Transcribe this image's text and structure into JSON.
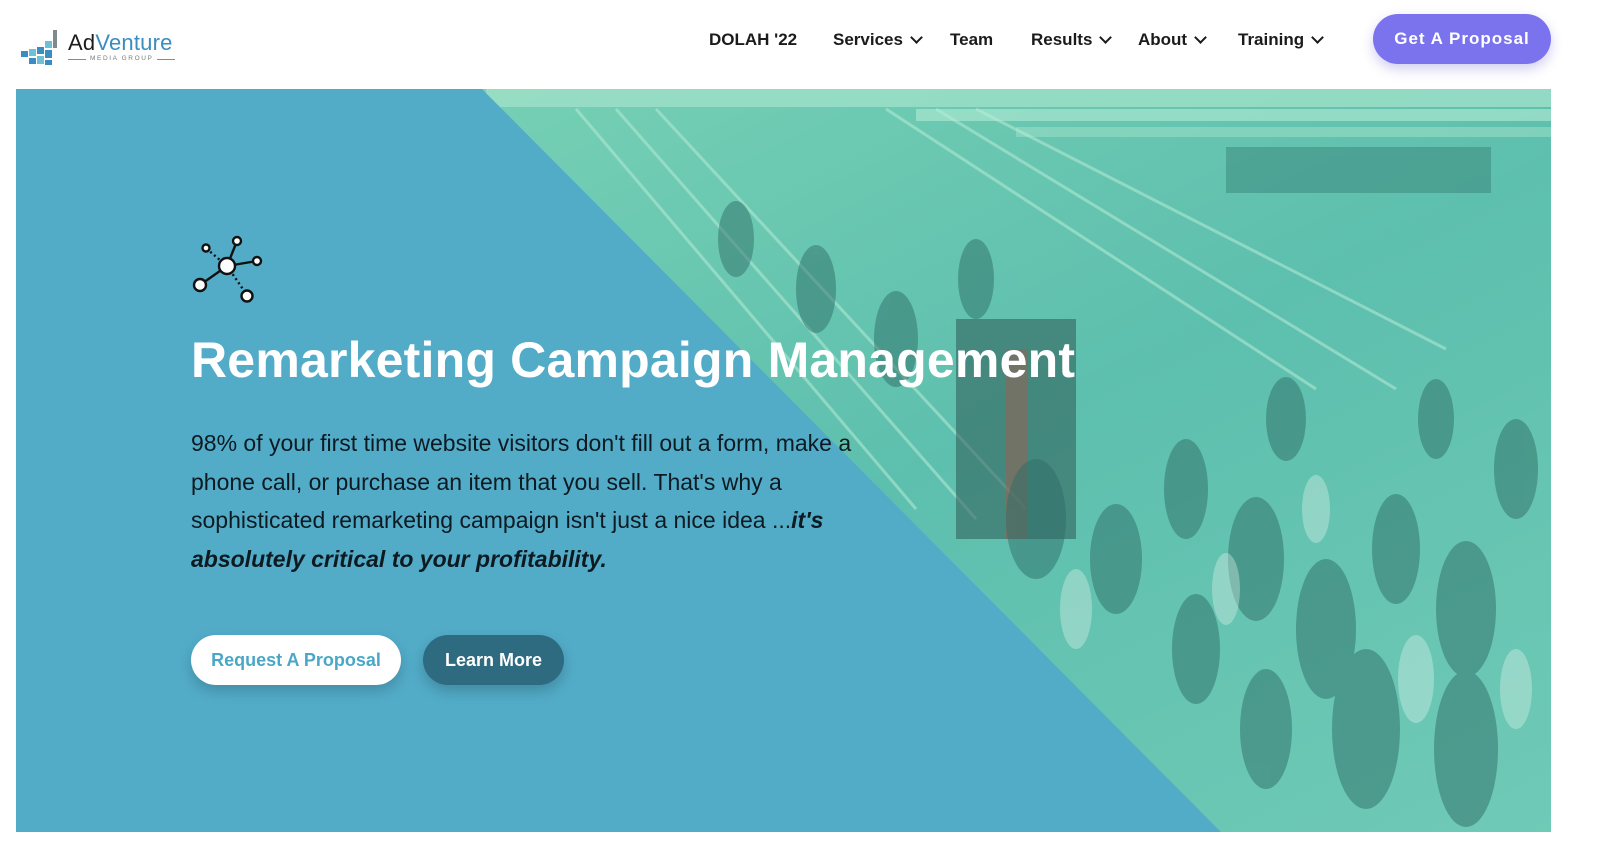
{
  "header": {
    "logo": {
      "name_part1": "Ad",
      "name_part2": "Venture",
      "subtitle": "MEDIA GROUP"
    },
    "nav": [
      {
        "label": "DOLAH '22",
        "has_dropdown": false
      },
      {
        "label": "Services",
        "has_dropdown": true
      },
      {
        "label": "Team",
        "has_dropdown": false
      },
      {
        "label": "Results",
        "has_dropdown": true
      },
      {
        "label": "About",
        "has_dropdown": true
      },
      {
        "label": "Training",
        "has_dropdown": true
      }
    ],
    "cta_label": "Get A Proposal"
  },
  "hero": {
    "icon": "network-nodes-icon",
    "title": "Remarketing Campaign Management",
    "body_text": "98% of your first time website visitors don't fill out a form, make a phone call, or purchase an item that you sell. That's why a sophisticated remarketing campaign isn't just a nice idea ...",
    "body_emphasis": "it's absolutely critical to your profitability.",
    "primary_button": "Request A Proposal",
    "secondary_button": "Learn More",
    "background_image": "crowd-train-station-photo"
  },
  "colors": {
    "brand_blue": "#3b8cc0",
    "hero_blue": "#52acc8",
    "photo_tint": "#6fd4b4",
    "cta_purple": "#7b73ee",
    "learn_more_bg": "#2e6a80",
    "request_text": "#4aa8c6"
  }
}
